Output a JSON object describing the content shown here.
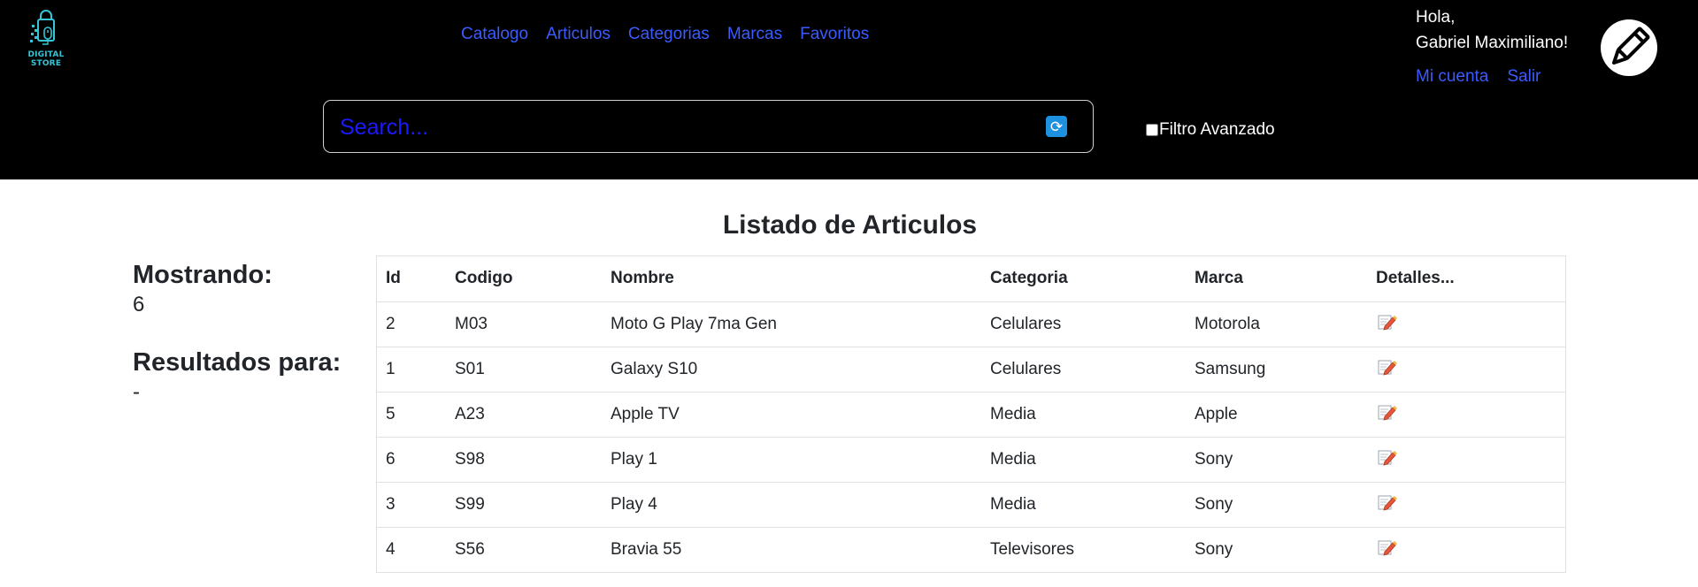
{
  "brand": {
    "name": "DIGITAL STORE",
    "accent": "#36c5d6"
  },
  "nav": {
    "links": [
      {
        "label": "Catalogo"
      },
      {
        "label": "Articulos"
      },
      {
        "label": "Categorias"
      },
      {
        "label": "Marcas"
      },
      {
        "label": "Favoritos"
      }
    ]
  },
  "user": {
    "greeting_line1": "Hola,",
    "greeting_line2": "Gabriel Maximiliano!",
    "account_label": "Mi cuenta",
    "logout_label": "Salir",
    "avatar_icon": "pencil-icon"
  },
  "search": {
    "placeholder": "Search...",
    "value": "",
    "button_icon": "refresh-icon"
  },
  "filter": {
    "label": "Filtro Avanzado",
    "checked": false
  },
  "page": {
    "title": "Listado de Articulos"
  },
  "summary": {
    "showing_label": "Mostrando:",
    "showing_value": "6",
    "results_label": "Resultados para:",
    "results_value": "-"
  },
  "table": {
    "headers": [
      "Id",
      "Codigo",
      "Nombre",
      "Categoria",
      "Marca",
      "Detalles..."
    ],
    "rows": [
      [
        "2",
        "M03",
        "Moto G Play 7ma Gen",
        "Celulares",
        "Motorola"
      ],
      [
        "1",
        "S01",
        "Galaxy S10",
        "Celulares",
        "Samsung"
      ],
      [
        "5",
        "A23",
        "Apple TV",
        "Media",
        "Apple"
      ],
      [
        "6",
        "S98",
        "Play 1",
        "Media",
        "Sony"
      ],
      [
        "3",
        "S99",
        "Play 4",
        "Media",
        "Sony"
      ],
      [
        "4",
        "S56",
        "Bravia 55",
        "Televisores",
        "Sony"
      ]
    ],
    "details_icon": "edit-icon"
  },
  "colors": {
    "navbar_bg": "#000000",
    "link": "#3b5bff",
    "search_text": "#1a1aff",
    "refresh_button": "#1e90e0"
  }
}
